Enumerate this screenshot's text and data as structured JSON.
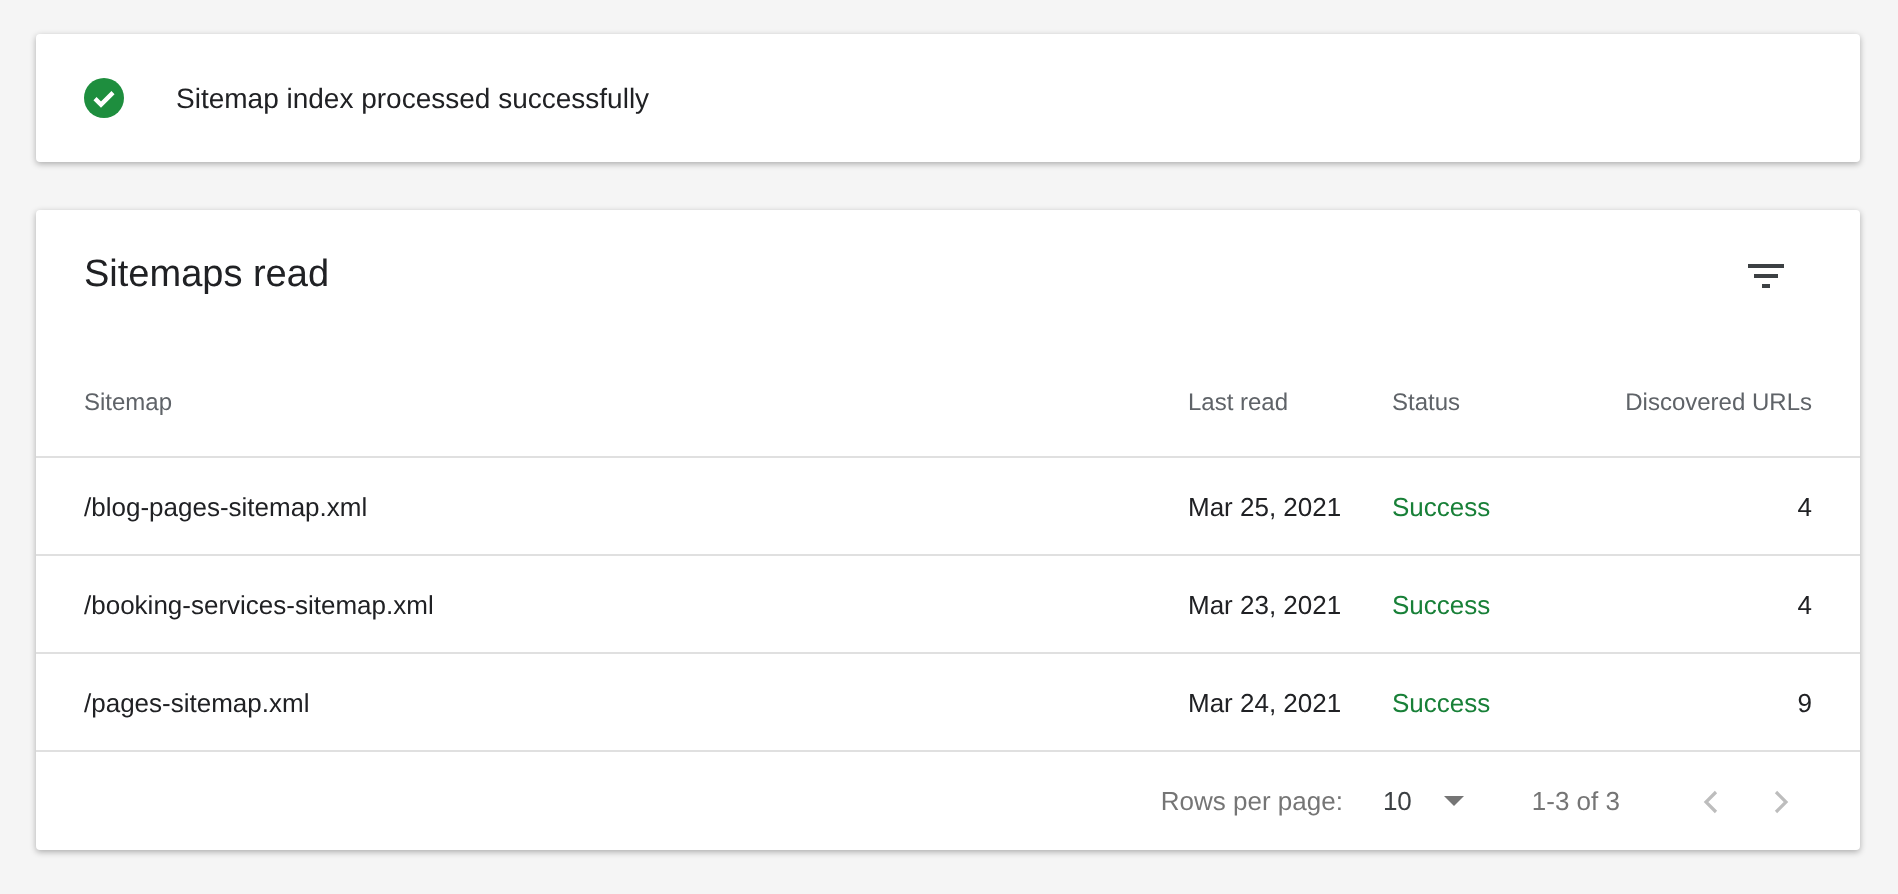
{
  "banner": {
    "message": "Sitemap index processed successfully"
  },
  "table": {
    "title": "Sitemaps read",
    "columns": [
      "Sitemap",
      "Last read",
      "Status",
      "Discovered URLs"
    ],
    "rows": [
      {
        "sitemap": "/blog-pages-sitemap.xml",
        "last_read": "Mar 25, 2021",
        "status": "Success",
        "urls": "4"
      },
      {
        "sitemap": "/booking-services-sitemap.xml",
        "last_read": "Mar 23, 2021",
        "status": "Success",
        "urls": "4"
      },
      {
        "sitemap": "/pages-sitemap.xml",
        "last_read": "Mar 24, 2021",
        "status": "Success",
        "urls": "9"
      }
    ],
    "pagination": {
      "rows_label": "Rows per page:",
      "rows_value": "10",
      "range": "1-3 of 3",
      "prev_disabled": true,
      "next_disabled": true
    }
  }
}
